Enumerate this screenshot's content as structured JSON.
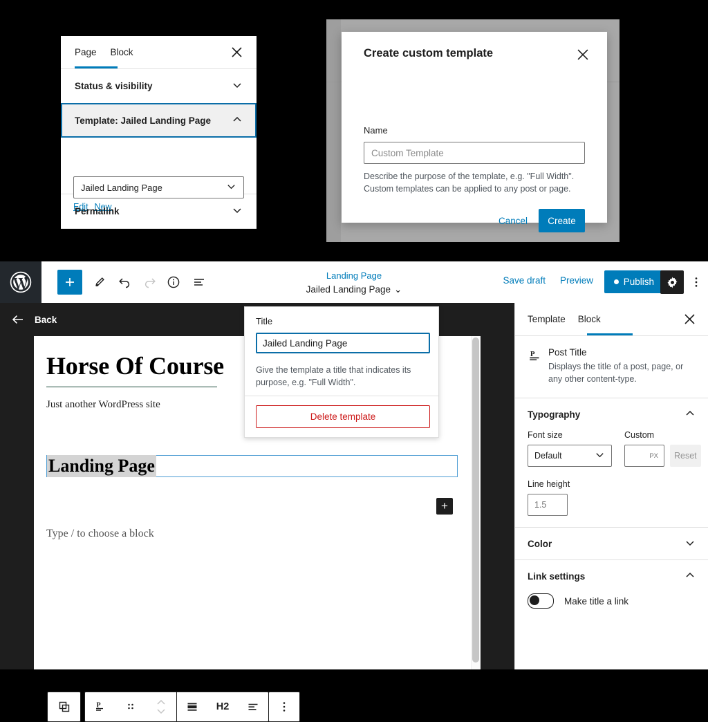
{
  "page_panel": {
    "tabs": [
      {
        "label": "Page",
        "active": true
      },
      {
        "label": "Block",
        "active": false
      }
    ],
    "close_icon": "close-icon",
    "sections": [
      {
        "label": "Status & visibility",
        "expanded": false
      },
      {
        "label": "Template: Jailed Landing Page",
        "expanded": true
      },
      {
        "label": "Permalink",
        "expanded": false
      }
    ],
    "template_select_value": "Jailed Landing Page",
    "links": [
      {
        "label": "Edit"
      },
      {
        "label": "New"
      }
    ]
  },
  "modal": {
    "title": "Create custom template",
    "close_icon": "close-icon",
    "name_label": "Name",
    "name_value": "",
    "name_placeholder": "Custom Template",
    "help": "Describe the purpose of the template, e.g. \"Full Width\". Custom templates can be applied to any post or page.",
    "cancel_label": "Cancel",
    "create_label": "Create",
    "accent_color": "#007cba"
  },
  "editor": {
    "header": {
      "logo": "wordpress-logo",
      "add_block_label": "+",
      "tools": [
        "edit-pencil-icon",
        "undo-icon",
        "redo-icon",
        "info-icon",
        "list-view-icon"
      ],
      "document_subtitle": "Landing Page",
      "document_title": "Jailed Landing Page",
      "document_caret": "⌄",
      "save_draft_label": "Save draft",
      "preview_label": "Preview",
      "publish_label": "Publish",
      "settings_icon": "gear-icon",
      "more_icon": "more-options-icon"
    },
    "back_label": "Back",
    "canvas": {
      "site_title": "Horse Of Course",
      "site_tagline": "Just another WordPress site",
      "heading_text": "Landing Page",
      "paragraph_placeholder": "Type / to choose a block",
      "appender_label": "+"
    },
    "block_toolbar": {
      "items": [
        {
          "name": "select-parent-icon",
          "label": ""
        },
        {
          "name": "post-title-block-icon",
          "label": ""
        },
        {
          "name": "drag-handle-icon",
          "label": ""
        },
        {
          "name": "move-updown-icon",
          "label": ""
        },
        {
          "name": "align-icon",
          "label": ""
        },
        {
          "name": "heading-level-button",
          "label": "H2"
        },
        {
          "name": "text-align-icon",
          "label": ""
        },
        {
          "name": "more-options-icon",
          "label": ""
        }
      ],
      "heading_level_label": "H2"
    },
    "title_popover": {
      "label": "Title",
      "value": "Jailed Landing Page",
      "help": "Give the template a title that indicates its purpose, e.g. \"Full Width\".",
      "delete_label": "Delete template",
      "danger_color": "#cc1818"
    },
    "sidebar": {
      "tabs": [
        {
          "label": "Template",
          "active": false
        },
        {
          "label": "Block",
          "active": true
        }
      ],
      "close_icon": "close-icon",
      "block_card": {
        "icon": "post-title-icon",
        "name": "Post Title",
        "description": "Displays the title of a post, page, or any other content-type."
      },
      "typography": {
        "header": "Typography",
        "expanded": true,
        "font_size_label": "Font size",
        "font_size_value": "Default",
        "custom_label": "Custom",
        "custom_value": "",
        "custom_unit": "PX",
        "reset_label": "Reset",
        "line_height_label": "Line height",
        "line_height_value": "",
        "line_height_placeholder": "1.5"
      },
      "color": {
        "header": "Color",
        "expanded": false
      },
      "link_settings": {
        "header": "Link settings",
        "expanded": true,
        "toggle_label": "Make title a link",
        "toggle_on": false
      }
    }
  }
}
